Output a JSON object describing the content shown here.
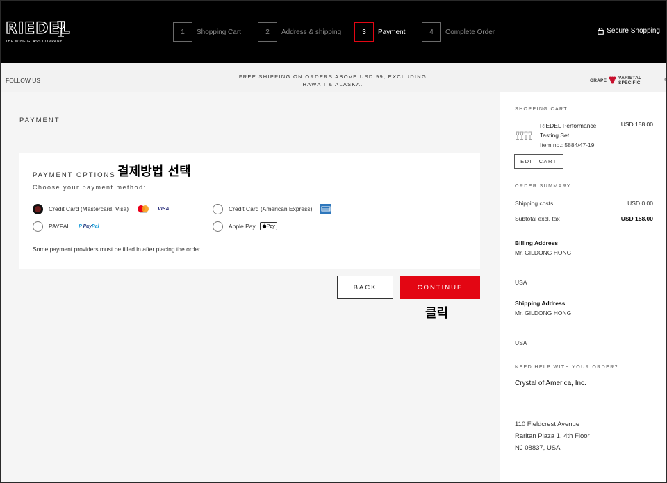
{
  "header": {
    "logo_text": "RIEDEL",
    "logo_tagline": "THE WINE GLASS COMPANY",
    "steps": [
      {
        "num": "1",
        "label": "Shopping Cart"
      },
      {
        "num": "2",
        "label": "Address & shipping"
      },
      {
        "num": "3",
        "label": "Payment"
      },
      {
        "num": "4",
        "label": "Complete Order"
      }
    ],
    "active_step": 3,
    "secure_label": "Secure Shopping"
  },
  "bar": {
    "follow": "FOLLOW US",
    "promo": "FREE SHIPPING ON ORDERS ABOVE USD 99, EXCLUDING HAWAII & ALASKA.",
    "grape_left": "GRAPE",
    "grape_right": "VARIETAL SPECIFIC",
    "grape_mark": "®"
  },
  "payment": {
    "title": "PAYMENT",
    "options_heading": "PAYMENT OPTIONS",
    "annotation_select": "결제방법 선택",
    "choose_text": "Choose your payment method:",
    "options": [
      {
        "label": "Credit Card (Mastercard, Visa)",
        "checked": true
      },
      {
        "label": "Credit Card (American Express)",
        "checked": false
      },
      {
        "label": "PAYPAL",
        "checked": false
      },
      {
        "label": "Apple Pay",
        "checked": false
      }
    ],
    "visa_text": "VISA",
    "paypal_logo_a": "Pay",
    "paypal_logo_b": "Pal",
    "applepay_text": "Pay",
    "note": "Some payment providers must be filled in after placing the order.",
    "back_label": "BACK",
    "continue_label": "CONTINUE",
    "annotation_click": "클릭"
  },
  "sidebar": {
    "cart_heading": "SHOPPING CART",
    "product_name": "RIEDEL Performance Tasting Set",
    "product_item": "Item no.: 5884/47-19",
    "product_price": "USD 158.00",
    "edit_cart": "EDIT CART",
    "summary_heading": "ORDER SUMMARY",
    "shipping_label": "Shipping costs",
    "shipping_value": "USD 0.00",
    "subtotal_label": "Subtotal excl. tax",
    "subtotal_value": "USD 158.00",
    "billing_title": "Billing Address",
    "billing_name": "Mr. GILDONG HONG",
    "billing_country": "USA",
    "shipping_title": "Shipping Address",
    "shipping_name": "Mr. GILDONG HONG",
    "shipping_country": "USA",
    "help_heading": "NEED HELP WITH YOUR ORDER?",
    "help_name": "Crystal of America, Inc.",
    "help_address": [
      "110 Fieldcrest Avenue",
      "Raritan Plaza 1, 4th Floor",
      "NJ 08837, USA"
    ]
  },
  "colors": {
    "accent_red": "#e30613",
    "header_bg": "#000000",
    "bar_bg": "#f2f2f2",
    "main_bg": "#f5f5f5"
  }
}
